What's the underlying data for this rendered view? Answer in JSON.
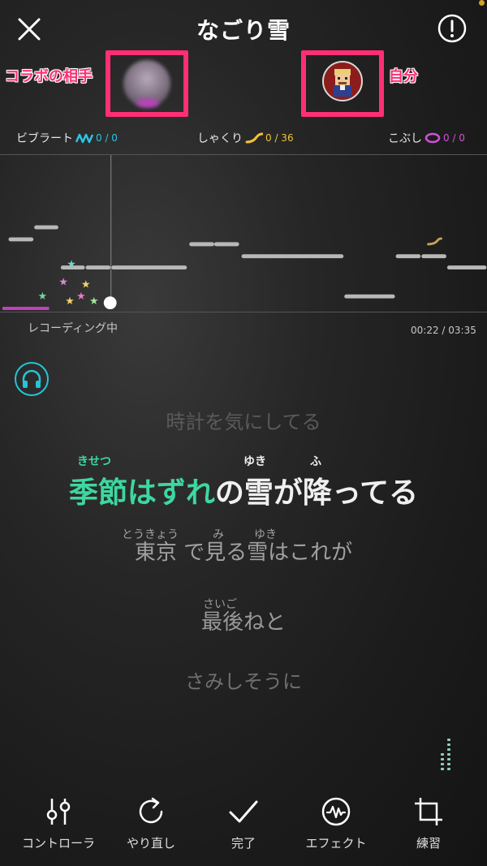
{
  "header": {
    "title": "なごり雪"
  },
  "collab": {
    "partner_label": "コラボの相手",
    "self_label": "自分"
  },
  "techniques": {
    "vibrato": {
      "label": "ビブラート",
      "count": "0 / 0",
      "color": "#2cc6e0"
    },
    "shakuri": {
      "label": "しゃくり",
      "count": "0 / 36",
      "color": "#f0c23a"
    },
    "kobushi": {
      "label": "こぶし",
      "count": "0 / 0",
      "color": "#d050d8"
    }
  },
  "recording": {
    "status": "レコーディング中",
    "time": "00:22 / 03:35"
  },
  "lyrics": {
    "prev": "時計を気にしてる",
    "current": {
      "sung": "季節はずれ",
      "rest_1": "の",
      "rest_2": "雪",
      "rest_3": "が",
      "rest_4": "降",
      "rest_5": "ってる",
      "ruby_kisetsu": "きせつ",
      "ruby_yuki": "ゆき",
      "ruby_fu": "ふ"
    },
    "next1": {
      "a": "東京",
      "b": " で",
      "c": "見",
      "d": "る",
      "e": "雪",
      "f": "はこれが",
      "ruby_toukyou": "とうきょう",
      "ruby_mi": "み",
      "ruby_yuki": "ゆき"
    },
    "next2": {
      "text": "最後ねと",
      "ruby_saigo": "さいご"
    },
    "next3": "さみしそうに"
  },
  "toolbar": {
    "controller": "コントローラ",
    "redo": "やり直し",
    "done": "完了",
    "effect": "エフェクト",
    "practice": "練習"
  },
  "colors": {
    "accent_pink": "#ff2f74",
    "sung_green": "#3ed7a0",
    "headphone_cyan": "#27c3d7"
  }
}
